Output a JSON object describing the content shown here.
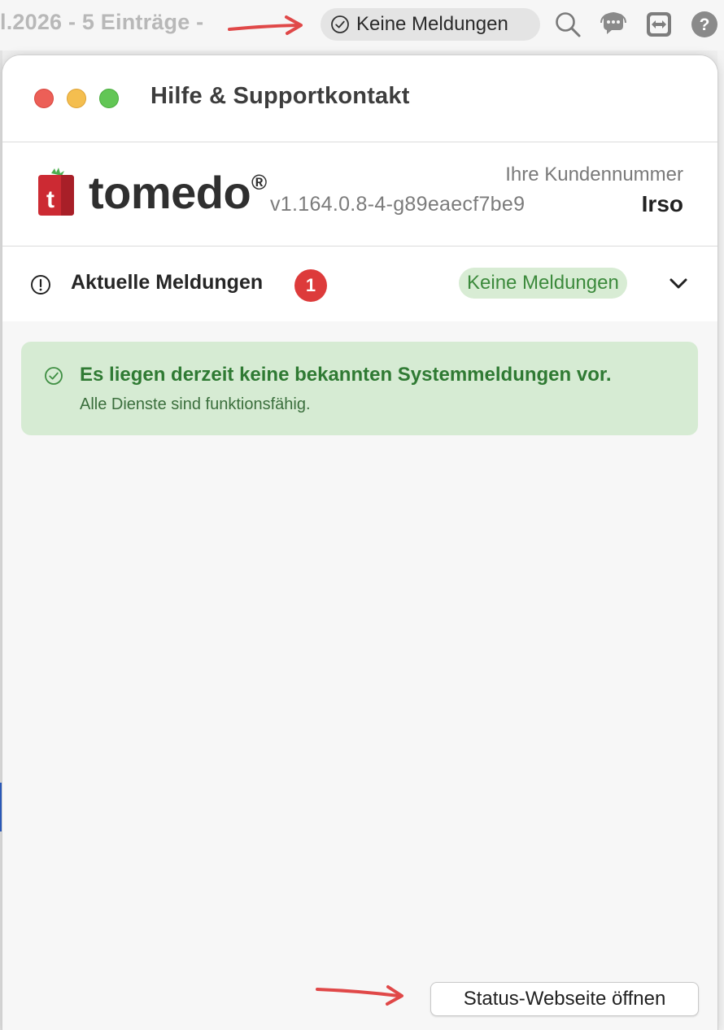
{
  "background": {
    "title_fragment": "l.2026 - 5 Einträge -",
    "status_chip_label": "Keine Meldungen",
    "toolbar_icons": [
      "search-icon",
      "support-chat-icon",
      "remote-support-icon",
      "help-icon"
    ]
  },
  "window": {
    "title": "Hilfe & Supportkontakt",
    "traffic_lights": [
      "close",
      "minimize",
      "maximize"
    ]
  },
  "brand": {
    "logo_letter": "t",
    "logo_word": "tomedo",
    "logo_reg": "®",
    "version": "v1.164.0.8-4-g89eaecf7be9",
    "customer_label": "Ihre Kundennummer",
    "customer_value": "Irso"
  },
  "messages": {
    "label": "Aktuelle Meldungen",
    "badge": "1",
    "status_pill": "Keine Meldungen"
  },
  "info_card": {
    "title": "Es liegen derzeit keine bekannten Systemmeldungen vor.",
    "subtitle": "Alle Dienste sind funktionsfähig."
  },
  "footer": {
    "status_button_label": "Status-Webseite öffnen"
  },
  "colors": {
    "success_green": "#2f7a33",
    "success_bg": "#d6ebd3",
    "badge_red": "#dd3b3b",
    "annotation_arrow": "#e04848"
  }
}
